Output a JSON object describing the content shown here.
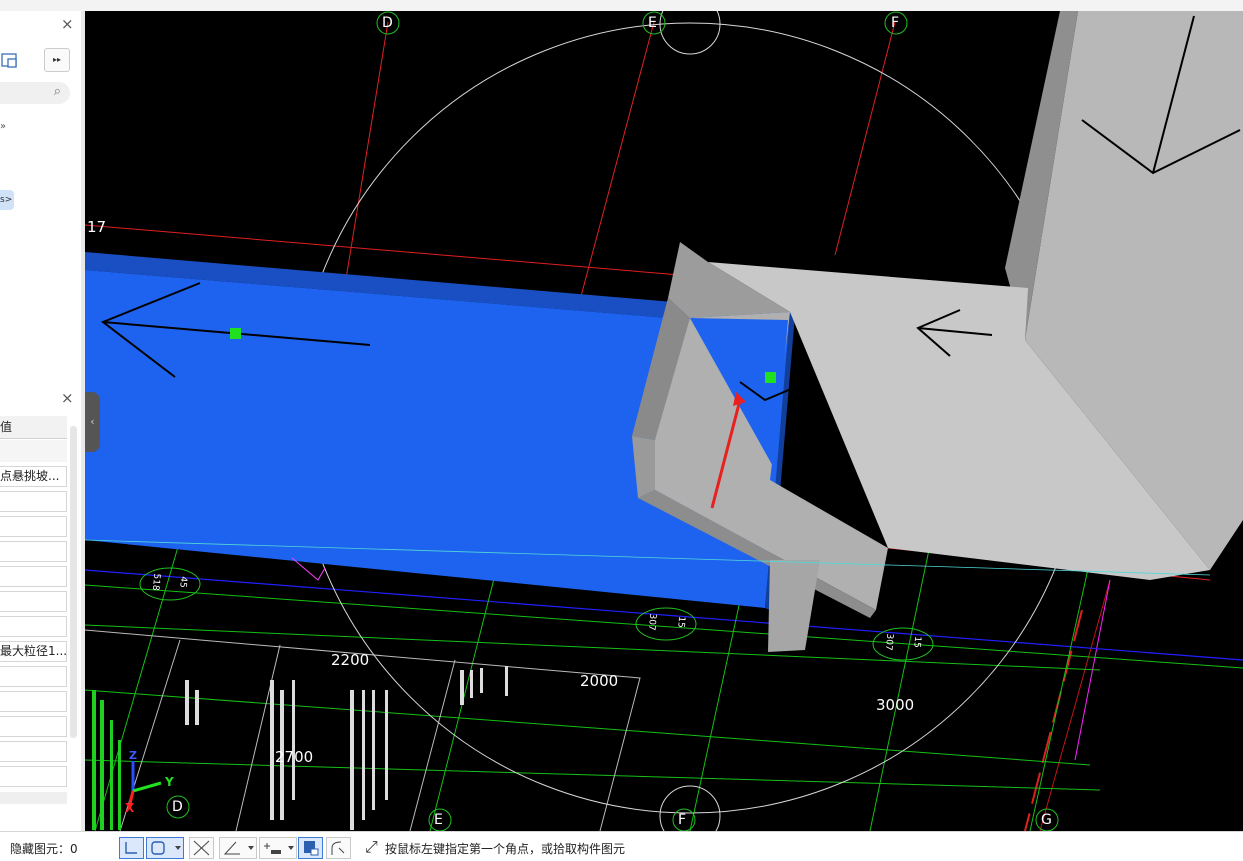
{
  "left_panel_top": {
    "close_glyph": "×",
    "expand_glyph": "▸▸",
    "search_glyph": "⌕",
    "tree_glyph_1": "»",
    "tree_selected_glyph": "s>"
  },
  "left_panel_bottom": {
    "close_glyph": "×",
    "header_label": "值",
    "rows": [
      "点悬挑坡...",
      "",
      "",
      "",
      "",
      "",
      "",
      "最大粒径1...",
      "",
      "",
      "",
      "",
      ""
    ],
    "collapse_glyph": "‹"
  },
  "viewport": {
    "grid_labels": {
      "d": "D",
      "e": "E",
      "f": "F",
      "d_bottom": "D",
      "e_bottom": "E",
      "f_bottom": "F",
      "g_bottom": "G",
      "row_17": "17"
    },
    "dimensions": {
      "d2200": "2200",
      "d2000": "2000",
      "d3000": "3000",
      "d2700": "2700"
    },
    "beam_tags": {
      "tag1_a": "518",
      "tag1_b": "45",
      "tag2_a": "307",
      "tag2_b": "15",
      "tag3_a": "307",
      "tag3_b": "15"
    },
    "axis": {
      "x": "X",
      "y": "Y",
      "z": "Z"
    },
    "colors": {
      "slab": "#1e63f0",
      "wall": "#a9a9a9",
      "background": "#000000"
    }
  },
  "statusbar": {
    "hidden_label": "隐藏图元：0",
    "hint": "按鼠标左键指定第一个角点，或拾取构件图元",
    "hint_icon": "⤢"
  }
}
